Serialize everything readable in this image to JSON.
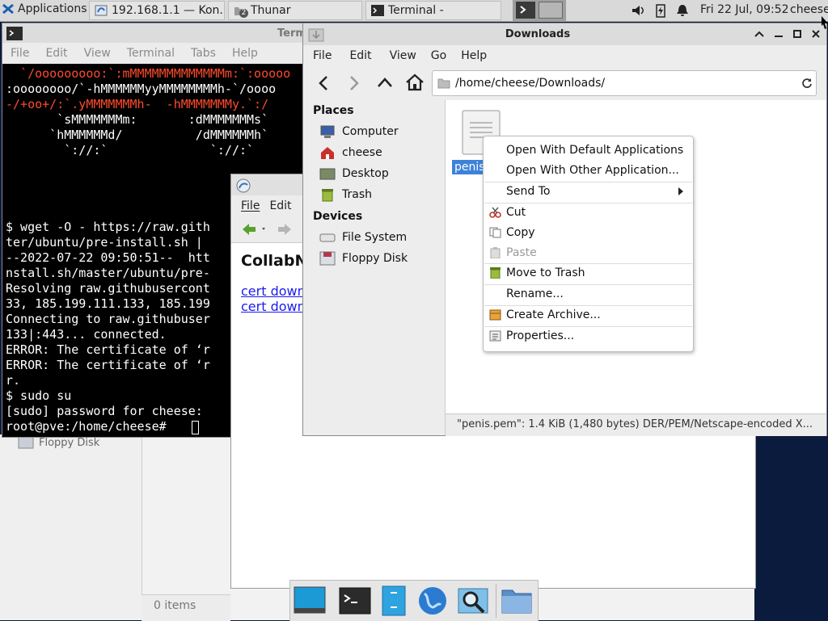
{
  "panel": {
    "apps_label": "Applications",
    "tasks": [
      {
        "label": "192.168.1.1 — Kon...",
        "icon": "browser-icon"
      },
      {
        "label": "Thunar",
        "icon": "folder-icon",
        "badge": "2"
      },
      {
        "label": "Terminal -",
        "icon": "terminal-icon"
      }
    ],
    "clock": "Fri 22 Jul, 09:52",
    "user": "cheese"
  },
  "terminal": {
    "title": "Termi",
    "menu": [
      "File",
      "Edit",
      "View",
      "Terminal",
      "Tabs",
      "Help"
    ],
    "art": [
      "  `/ooooooooo:`:mMMMMMMMMMMMMMm:`:ooooo",
      ":oooooooo/`-hMMMMMMyyMMMMMMMMh-`/oooo",
      "-/+oo+/:`.yMMMMMMMh-  -hMMMMMMMy.`:/",
      "       `sMMMMMMMm:       :dMMMMMMMs`",
      "      `hMMMMMMd/          /dMMMMMMh`",
      "        `://:`              `://:`"
    ],
    "lines": [
      "$ wget -O - https://raw.gith",
      "ter/ubuntu/pre-install.sh |",
      "--2022-07-22 09:50:51--  htt",
      "nstall.sh/master/ubuntu/pre-",
      "Resolving raw.githubusercont",
      "33, 185.199.111.133, 185.199",
      "Connecting to raw.githubuser",
      "133|:443... connected.",
      "ERROR: The certificate of ‘r",
      "ERROR: The certificate of ‘r",
      "r.",
      "$ sudo su",
      "[sudo] password for cheese:",
      "root@pve:/home/cheese# "
    ]
  },
  "back_thunar": {
    "floppy": "Floppy Disk",
    "items_count": "0 items"
  },
  "browser": {
    "menu": [
      "File",
      "Edit"
    ],
    "heading": "CollabN",
    "links": [
      "cert down",
      "cert down"
    ]
  },
  "thunar": {
    "title": "Downloads",
    "menu": [
      "File",
      "Edit",
      "View",
      "Go",
      "Help"
    ],
    "path": "/home/cheese/Downloads/",
    "places_header": "Places",
    "places": [
      {
        "label": "Computer",
        "icon": "computer-icon"
      },
      {
        "label": "cheese",
        "icon": "home-icon"
      },
      {
        "label": "Desktop",
        "icon": "desktop-icon"
      },
      {
        "label": "Trash",
        "icon": "trash-icon"
      }
    ],
    "devices_header": "Devices",
    "devices": [
      {
        "label": "File System",
        "icon": "drive-icon"
      },
      {
        "label": "Floppy Disk",
        "icon": "floppy-icon"
      }
    ],
    "file_label": "penis",
    "status": "\"penis.pem\": 1.4 KiB (1,480 bytes) DER/PEM/Netscape-encoded X..."
  },
  "context_menu": {
    "items": [
      {
        "label": "Open With Default Applications",
        "icon": "",
        "enabled": true
      },
      {
        "label": "Open With Other Application...",
        "icon": "",
        "enabled": true
      },
      {
        "label": "Send To",
        "icon": "submenu-arrow",
        "enabled": true
      },
      {
        "label": "Cut",
        "icon": "scissors-icon",
        "enabled": true
      },
      {
        "label": "Copy",
        "icon": "copy-icon",
        "enabled": true
      },
      {
        "label": "Paste",
        "icon": "paste-icon",
        "enabled": false
      },
      {
        "label": "Move to Trash",
        "icon": "trash-icon",
        "enabled": true
      },
      {
        "label": "Rename...",
        "icon": "",
        "enabled": true
      },
      {
        "label": "Create Archive...",
        "icon": "archive-icon",
        "enabled": true
      },
      {
        "label": "Properties...",
        "icon": "properties-icon",
        "enabled": true
      }
    ]
  },
  "dock": {
    "items": [
      "show-desktop-icon",
      "terminal-icon",
      "file-manager-icon",
      "web-browser-icon",
      "app-finder-icon",
      "folder-icon"
    ]
  },
  "colors": {
    "desktop_bg": "#0b1b3d",
    "selection": "#3d82d8",
    "terminal_red": "#ff4b2b"
  }
}
